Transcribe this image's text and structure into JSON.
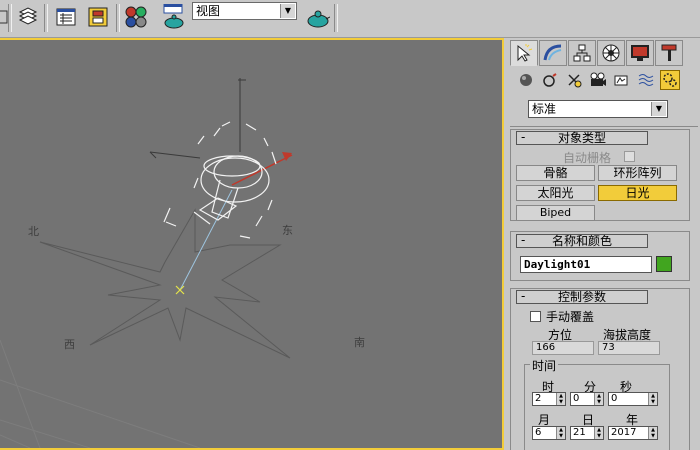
{
  "toolbar": {
    "view_dropdown_value": "视图",
    "icons": [
      "layer-manager-icon",
      "layers-icon",
      "track-view-icon",
      "schematic-view-icon",
      "material-editor-icon",
      "render-setup-icon",
      "quick-render-icon",
      "render-icon"
    ]
  },
  "viewport": {
    "compass": {
      "north": "北",
      "east": "东",
      "south": "南",
      "west": "西"
    },
    "accent_color": "#f2cc3a"
  },
  "panel": {
    "tabs": [
      "create-tab",
      "modify-tab",
      "hierarchy-tab",
      "motion-tab",
      "display-tab",
      "utilities-tab"
    ],
    "subtabs": [
      "geometry-icon",
      "shapes-icon",
      "lights-icon",
      "cameras-icon",
      "helpers-icon",
      "space-warps-icon",
      "systems-icon"
    ],
    "category_dropdown_value": "标准",
    "object_type": {
      "title": "对象类型",
      "minus": "-",
      "auto_grid_label": "自动栅格",
      "buttons": [
        "骨骼",
        "环形阵列",
        "太阳光",
        "日光",
        "Biped"
      ],
      "active_button": "日光"
    },
    "name_color": {
      "title": "名称和颜色",
      "minus": "-",
      "name_value": "Daylight01",
      "color": "#41a51f"
    },
    "control_params": {
      "title": "控制参数",
      "minus": "-",
      "manual_override_label": "手动覆盖",
      "azimuth_label": "方位",
      "altitude_label": "海拔高度",
      "azimuth_value": "166",
      "altitude_value": "73",
      "time_group_label": "时间",
      "hour_label": "时",
      "minute_label": "分",
      "second_label": "秒",
      "month_label": "月",
      "day_label": "日",
      "year_label": "年",
      "hour_value": "2",
      "minute_value": "0",
      "second_value": "0",
      "month_value": "6",
      "day_value": "21",
      "year_value": "2017"
    }
  }
}
